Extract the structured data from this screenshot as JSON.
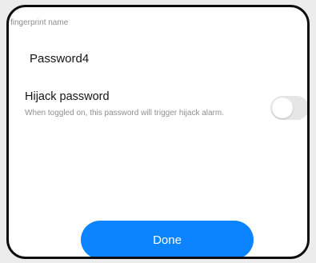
{
  "dialog": {
    "section_label": "fingerprint name",
    "fingerprint_name": "Password4",
    "hijack": {
      "title": "Hijack password",
      "description": "When toggled on, this password will trigger hijack alarm.",
      "toggle_state": "off"
    },
    "done_label": "Done"
  },
  "colors": {
    "accent": "#0d84ff",
    "toggle_off": "#e6e6e6",
    "secondary_text": "#8f8f8f"
  }
}
